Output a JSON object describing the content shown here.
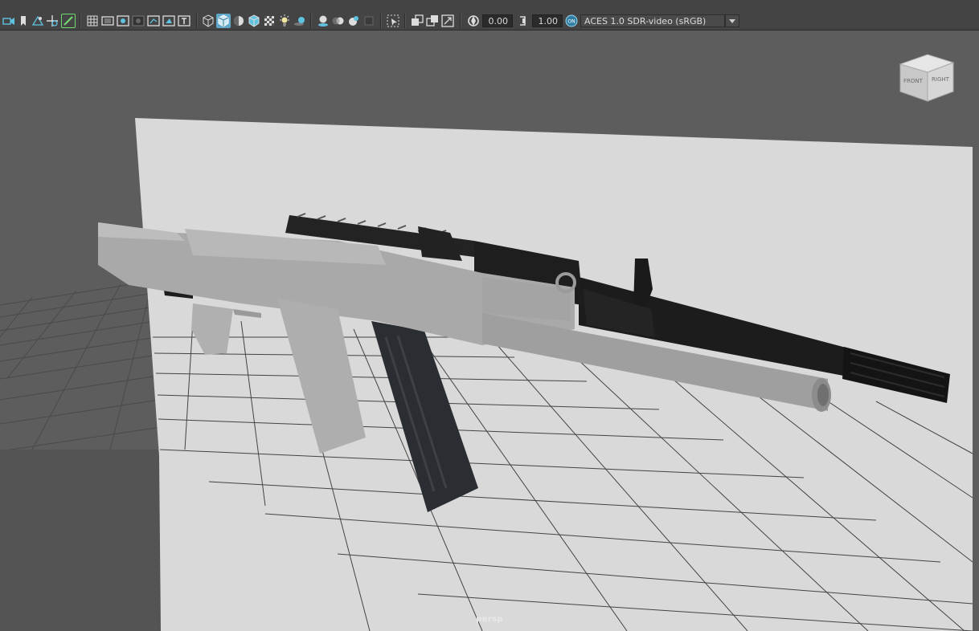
{
  "toolbar": {
    "icons": [
      "camera-icon",
      "bookmark-icon",
      "image-plane-icon",
      "2d-pan-zoom-icon",
      "grease-pencil-icon",
      "grid-icon",
      "film-gate-icon",
      "resolution-gate-icon",
      "gate-mask-icon",
      "field-chart-icon",
      "safe-action-icon",
      "safe-title-icon",
      "wireframe-icon",
      "smooth-shade-icon",
      "use-default-material-icon",
      "wireframe-on-shaded-icon",
      "textured-icon",
      "use-all-lights-icon",
      "shadows-icon",
      "screen-space-ao-icon",
      "motion-blur-icon",
      "multisample-aa-icon",
      "depth-of-field-icon",
      "isolate-select-icon",
      "xray-icon",
      "xray-joints-icon",
      "xray-active-components-icon",
      "exposure-icon",
      "gamma-icon",
      "color-management-icon"
    ],
    "exposure_value": "0.00",
    "gamma_value": "1.00",
    "color_space": "ACES 1.0 SDR-video (sRGB)",
    "accent_color": "#5fa8c9"
  },
  "viewport": {
    "camera_name": "persp",
    "viewcube": {
      "front_label": "FRONT",
      "right_label": "RIGHT"
    },
    "background_color": "#5d5d5d",
    "backdrop_color": "#d9d9d9"
  }
}
